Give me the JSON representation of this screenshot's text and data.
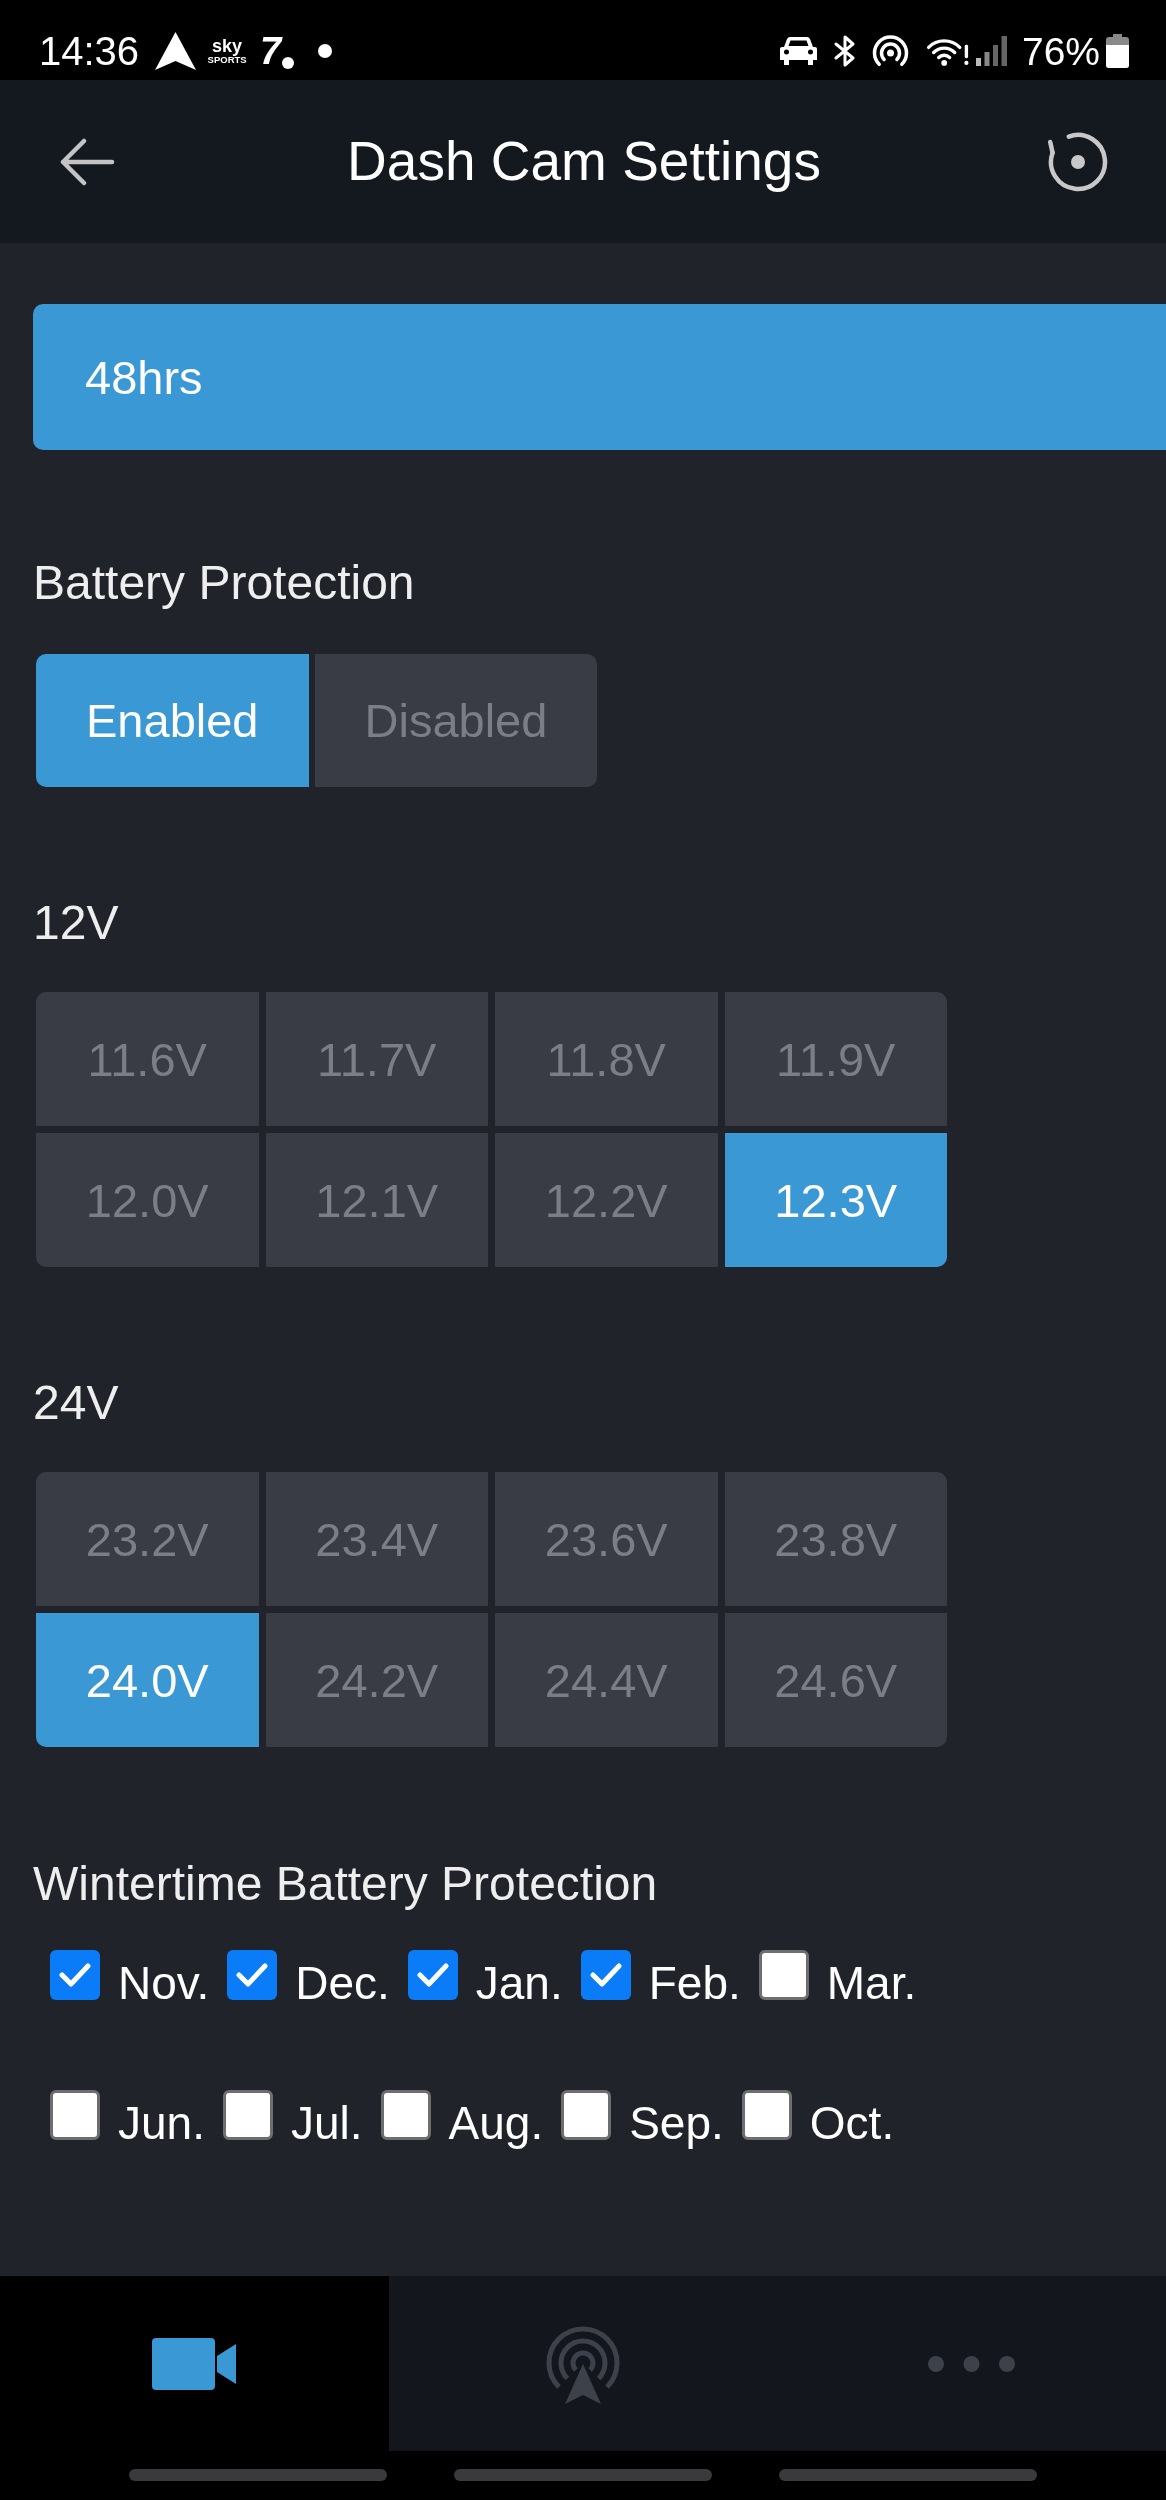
{
  "status_bar": {
    "time": "14:36",
    "sky_logo": {
      "wordmark": "sky",
      "caption": "SPORTS"
    },
    "logo_glyph": "7",
    "battery_percent": "76%"
  },
  "app_bar": {
    "title": "Dash Cam Settings"
  },
  "off_timer": {
    "value": "48hrs"
  },
  "battery_protection": {
    "label": "Battery Protection",
    "options": [
      {
        "label": "Enabled",
        "selected": true
      },
      {
        "label": "Disabled",
        "selected": false
      }
    ]
  },
  "voltage_groups": [
    {
      "label": "12V",
      "options": [
        {
          "label": "11.6V",
          "selected": false
        },
        {
          "label": "11.7V",
          "selected": false
        },
        {
          "label": "11.8V",
          "selected": false
        },
        {
          "label": "11.9V",
          "selected": false
        },
        {
          "label": "12.0V",
          "selected": false
        },
        {
          "label": "12.1V",
          "selected": false
        },
        {
          "label": "12.2V",
          "selected": false
        },
        {
          "label": "12.3V",
          "selected": true
        }
      ]
    },
    {
      "label": "24V",
      "options": [
        {
          "label": "23.2V",
          "selected": false
        },
        {
          "label": "23.4V",
          "selected": false
        },
        {
          "label": "23.6V",
          "selected": false
        },
        {
          "label": "23.8V",
          "selected": false
        },
        {
          "label": "24.0V",
          "selected": true
        },
        {
          "label": "24.2V",
          "selected": false
        },
        {
          "label": "24.4V",
          "selected": false
        },
        {
          "label": "24.6V",
          "selected": false
        }
      ]
    }
  ],
  "wintertime": {
    "label": "Wintertime Battery Protection",
    "rows": [
      [
        {
          "label": "Nov.",
          "checked": true
        },
        {
          "label": "Dec.",
          "checked": true
        },
        {
          "label": "Jan.",
          "checked": true
        },
        {
          "label": "Feb.",
          "checked": true
        },
        {
          "label": "Mar.",
          "checked": false
        }
      ],
      [
        {
          "label": "Jun.",
          "checked": false
        },
        {
          "label": "Jul.",
          "checked": false
        },
        {
          "label": "Aug.",
          "checked": false
        },
        {
          "label": "Sep.",
          "checked": false
        },
        {
          "label": "Oct.",
          "checked": false
        }
      ]
    ]
  },
  "bottom_nav": {
    "tabs": [
      {
        "kind": "camera",
        "selected": true
      },
      {
        "kind": "radar",
        "selected": false
      },
      {
        "kind": "more",
        "selected": false
      }
    ]
  }
}
